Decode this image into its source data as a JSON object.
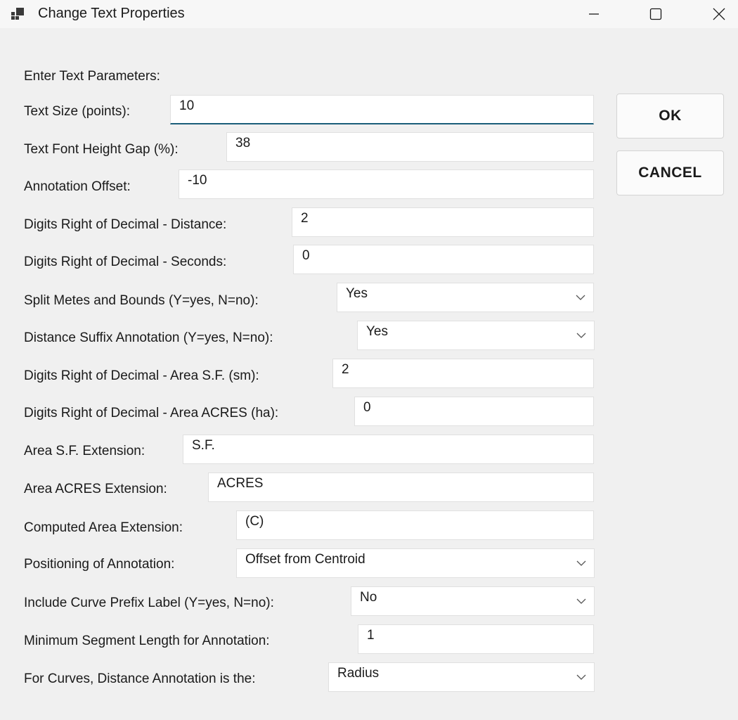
{
  "window": {
    "title": "Change Text Properties"
  },
  "dialog": {
    "heading": "Enter Text Parameters:",
    "ok_label": "OK",
    "cancel_label": "CANCEL"
  },
  "fields": [
    {
      "label": "Text Size (points):",
      "value": "10",
      "type": "text",
      "focused": true
    },
    {
      "label": "Text Font Height Gap (%):",
      "value": "38",
      "type": "text"
    },
    {
      "label": "Annotation Offset:",
      "value": "-10",
      "type": "text"
    },
    {
      "label": "Digits Right of Decimal - Distance:",
      "value": "2",
      "type": "text"
    },
    {
      "label": "Digits Right of Decimal - Seconds:",
      "value": "0",
      "type": "text"
    },
    {
      "label": "Split Metes and Bounds (Y=yes, N=no):",
      "value": "Yes",
      "type": "select"
    },
    {
      "label": "Distance Suffix Annotation (Y=yes, N=no):",
      "value": "Yes",
      "type": "select"
    },
    {
      "label": "Digits Right of Decimal - Area S.F. (sm):",
      "value": "2",
      "type": "text"
    },
    {
      "label": "Digits Right of Decimal - Area ACRES (ha):",
      "value": "0",
      "type": "text"
    },
    {
      "label": "Area S.F. Extension:",
      "value": "S.F.",
      "type": "text"
    },
    {
      "label": "Area ACRES Extension:",
      "value": "ACRES",
      "type": "text"
    },
    {
      "label": "Computed Area Extension:",
      "value": "(C)",
      "type": "text"
    },
    {
      "label": "Positioning of Annotation:",
      "value": "Offset from Centroid",
      "type": "select"
    },
    {
      "label": "Include Curve Prefix Label (Y=yes, N=no):",
      "value": "No",
      "type": "select"
    },
    {
      "label": "Minimum Segment Length for Annotation:",
      "value": "1",
      "type": "text"
    },
    {
      "label": "For Curves, Distance Annotation is the:",
      "value": "Radius",
      "type": "select"
    }
  ]
}
